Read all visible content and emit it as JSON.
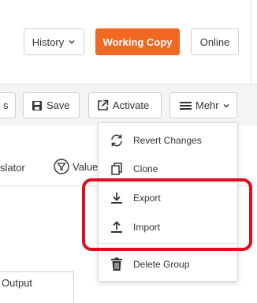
{
  "header": {
    "history_label": "History",
    "working_copy_label": "Working Copy",
    "online_label": "Online"
  },
  "toolbar": {
    "partial_label": "s",
    "save_label": "Save",
    "activate_label": "Activate",
    "more_label": "Mehr"
  },
  "row2": {
    "translator_partial": "slator",
    "value_partial": "Value"
  },
  "menu": {
    "items": [
      {
        "label": "Revert Changes",
        "icon": "revert-icon"
      },
      {
        "label": "Clone",
        "icon": "clone-icon"
      },
      {
        "label": "Export",
        "icon": "export-icon"
      },
      {
        "label": "Import",
        "icon": "import-icon"
      },
      {
        "label": "Delete Group",
        "icon": "trash-icon"
      }
    ]
  },
  "content": {
    "output_label": "Output"
  },
  "colors": {
    "accent": "#f26722",
    "highlight": "#e00d1e"
  }
}
